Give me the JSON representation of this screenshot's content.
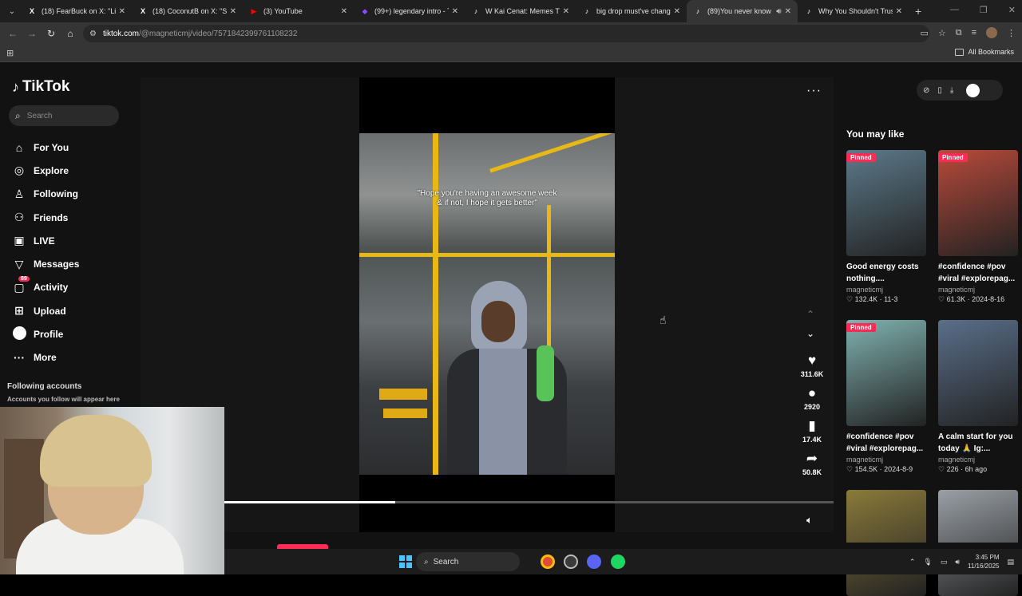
{
  "browser": {
    "tabs": [
      {
        "title": "(18) FearBuck on X: \"Lil Ty",
        "favicon": "x-logo-icon",
        "active": false
      },
      {
        "title": "(18) CoconutB on X: \"S",
        "favicon": "x-logo-icon",
        "active": false
      },
      {
        "title": "(3) YouTube",
        "favicon": "youtube-icon",
        "active": false
      },
      {
        "title": "(99+) legendary intro - Tw",
        "favicon": "twitch-icon",
        "active": false
      },
      {
        "title": "W Kai Cenat: Memes That",
        "favicon": "tiktok-icon",
        "active": false
      },
      {
        "title": "big drop must've change",
        "favicon": "tiktok-icon",
        "active": false
      },
      {
        "title": "(89)You never know w",
        "favicon": "tiktok-icon",
        "active": true
      },
      {
        "title": "Why You Shouldn't Trust",
        "favicon": "tiktok-icon",
        "active": false
      }
    ],
    "url_host": "tiktok.com",
    "url_path": "/@magneticmj/video/7571842399761108232",
    "bookmarks_label": "All Bookmarks"
  },
  "tiktok": {
    "logo_text": "TikTok",
    "search_placeholder": "Search",
    "nav": [
      {
        "label": "For You",
        "icon": "home-icon",
        "glyph": "⌂"
      },
      {
        "label": "Explore",
        "icon": "compass-icon",
        "glyph": "◎"
      },
      {
        "label": "Following",
        "icon": "person-plus-icon",
        "glyph": "♙"
      },
      {
        "label": "Friends",
        "icon": "friends-icon",
        "glyph": "⚇"
      },
      {
        "label": "LIVE",
        "icon": "live-icon",
        "glyph": "▣"
      },
      {
        "label": "Messages",
        "icon": "messages-icon",
        "glyph": "▽"
      },
      {
        "label": "Activity",
        "icon": "activity-icon",
        "glyph": "▢",
        "badge": "89"
      },
      {
        "label": "Upload",
        "icon": "upload-icon",
        "glyph": "⊞"
      },
      {
        "label": "Profile",
        "icon": "profile-icon",
        "glyph": ""
      },
      {
        "label": "More",
        "icon": "more-icon",
        "glyph": "···"
      }
    ],
    "following_title": "Following accounts",
    "following_subtitle": "Accounts you follow will appear here",
    "video": {
      "caption_line1": "\"Hope you're having an awesome week",
      "caption_line2": "& if not, I hope it gets better\"",
      "progress_fraction": 0.28,
      "likes": "311.6K",
      "comments": "2920",
      "saves": "17.4K",
      "shares": "50.8K"
    },
    "may_like_title": "You may like",
    "recommended": [
      {
        "pinned": "Pinned",
        "title": "Good energy costs nothing....",
        "user": "magneticmj",
        "meta": "♡ 132.4K · 11-3",
        "color": "#5c7a8a"
      },
      {
        "pinned": "Pinned",
        "title": "#confidence #pov #viral #explorepag...",
        "user": "magneticmj",
        "meta": "♡ 61.3K · 2024-8-16",
        "color": "#b84a3a"
      },
      {
        "pinned": "Pinned",
        "title": "#confidence #pov #viral #explorepag...",
        "user": "magneticmj",
        "meta": "♡ 154.5K · 2024-8-9",
        "color": "#7fb2b0"
      },
      {
        "pinned": "",
        "title": "A calm start for you today 🙏 Ig:...",
        "user": "magneticmj",
        "meta": "♡ 226 · 6h ago",
        "color": "#5a6f8a"
      },
      {
        "pinned": "",
        "title": "",
        "user": "",
        "meta": "",
        "color": "#8a7a3a"
      },
      {
        "pinned": "",
        "title": "",
        "user": "",
        "meta": "",
        "color": "#9aa0a6"
      }
    ]
  },
  "taskbar": {
    "search_label": "Search",
    "time": "3:45 PM",
    "date": "11/16/2025"
  }
}
